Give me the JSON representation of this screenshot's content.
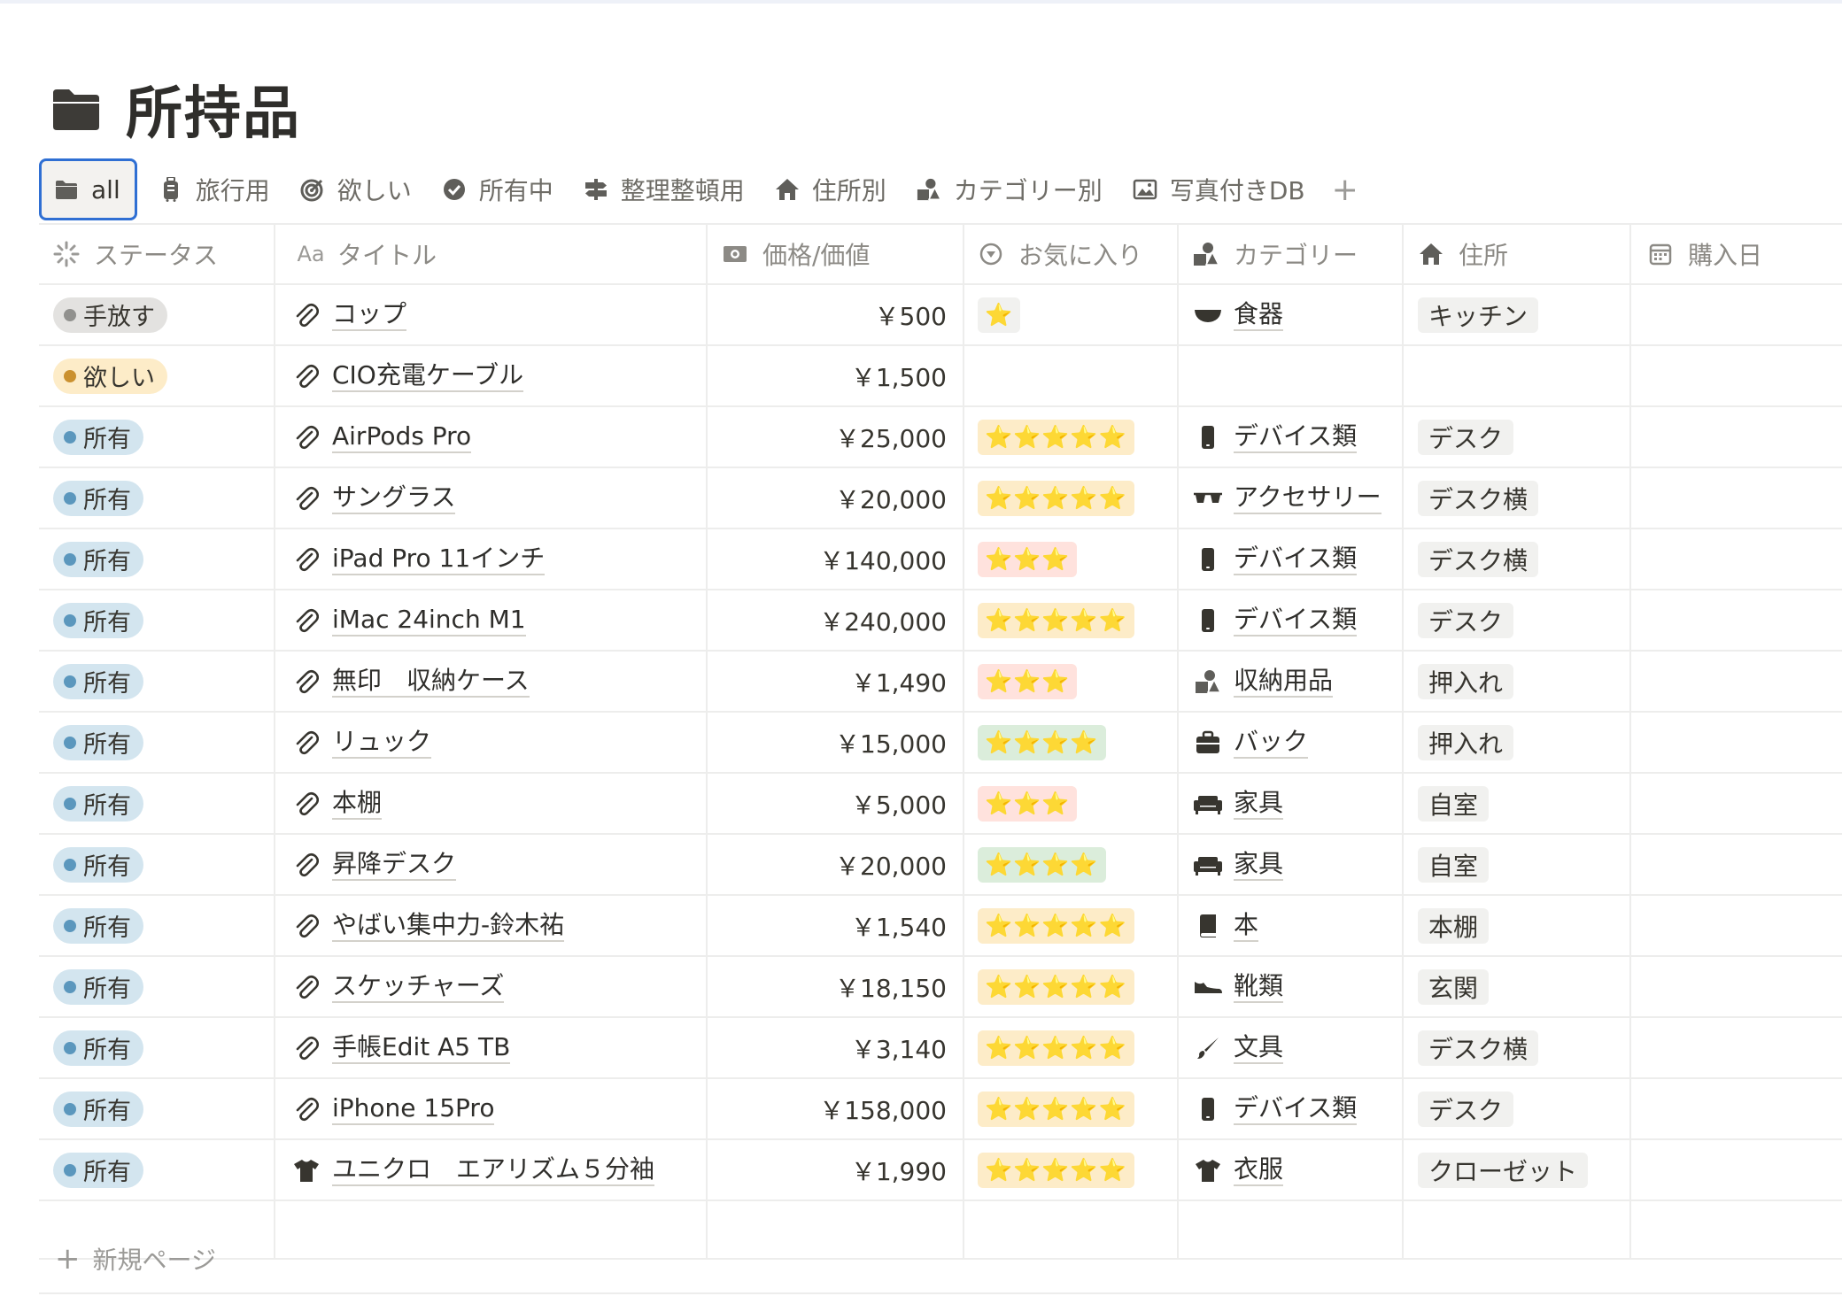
{
  "page": {
    "title": "所持品",
    "icon": "folder-icon"
  },
  "tabs": [
    {
      "label": "all",
      "icon": "folder-icon",
      "active": true
    },
    {
      "label": "旅行用",
      "icon": "luggage-icon"
    },
    {
      "label": "欲しい",
      "icon": "target-icon"
    },
    {
      "label": "所有中",
      "icon": "check-circle-icon"
    },
    {
      "label": "整理整頓用",
      "icon": "signpost-icon"
    },
    {
      "label": "住所別",
      "icon": "home-icon"
    },
    {
      "label": "カテゴリー別",
      "icon": "shapes-icon"
    },
    {
      "label": "写真付きDB",
      "icon": "image-icon"
    }
  ],
  "columns": [
    {
      "label": "ステータス",
      "icon": "status-icon"
    },
    {
      "label": "タイトル",
      "icon": "text-aa-icon",
      "icon_text": "Aa"
    },
    {
      "label": "価格/価値",
      "icon": "money-icon"
    },
    {
      "label": "お気に入り",
      "icon": "select-icon"
    },
    {
      "label": "カテゴリー",
      "icon": "shapes-icon"
    },
    {
      "label": "住所",
      "icon": "home-icon"
    },
    {
      "label": "購入日",
      "icon": "calendar-icon"
    }
  ],
  "status_colors": {
    "手放す": {
      "bg": "#e3e2e0",
      "dot": "#91918e"
    },
    "欲しい": {
      "bg": "#fdecc8",
      "dot": "#cb912f"
    },
    "所有": {
      "bg": "#d3e5ef",
      "dot": "#5b97bd"
    }
  },
  "star_colors": {
    "5": "#fdecc8",
    "4": "#dbeddb",
    "3": "#ffe2dd",
    "1": "#f1f1ef"
  },
  "rows": [
    {
      "status": "手放す",
      "title": "コップ",
      "title_icon": "paperclip-icon",
      "price": "￥500",
      "stars": 1,
      "stars_text": "⭐",
      "category": "食器",
      "category_icon": "bowl-icon",
      "location": "キッチン",
      "date": ""
    },
    {
      "status": "欲しい",
      "title": "CIO充電ケーブル",
      "title_icon": "paperclip-icon",
      "price": "￥1,500",
      "stars": 0,
      "stars_text": "",
      "category": "",
      "category_icon": "",
      "location": "",
      "date": ""
    },
    {
      "status": "所有",
      "title": "AirPods Pro",
      "title_icon": "paperclip-icon",
      "price": "￥25,000",
      "stars": 5,
      "stars_text": "⭐⭐⭐⭐⭐",
      "category": "デバイス類",
      "category_icon": "phone-icon",
      "location": "デスク",
      "date": ""
    },
    {
      "status": "所有",
      "title": "サングラス",
      "title_icon": "paperclip-icon",
      "price": "￥20,000",
      "stars": 5,
      "stars_text": "⭐⭐⭐⭐⭐",
      "category": "アクセサリー",
      "category_icon": "glasses-icon",
      "location": "デスク横",
      "date": ""
    },
    {
      "status": "所有",
      "title": "iPad Pro 11インチ",
      "title_icon": "paperclip-icon",
      "price": "￥140,000",
      "stars": 3,
      "stars_text": "⭐⭐⭐",
      "category": "デバイス類",
      "category_icon": "phone-icon",
      "location": "デスク横",
      "date": ""
    },
    {
      "status": "所有",
      "title": "iMac 24inch M1",
      "title_icon": "paperclip-icon",
      "price": "￥240,000",
      "stars": 5,
      "stars_text": "⭐⭐⭐⭐⭐",
      "category": "デバイス類",
      "category_icon": "phone-icon",
      "location": "デスク",
      "date": ""
    },
    {
      "status": "所有",
      "title": "無印　収納ケース",
      "title_icon": "paperclip-icon",
      "price": "￥1,490",
      "stars": 3,
      "stars_text": "⭐⭐⭐",
      "category": "収納用品",
      "category_icon": "shapes-icon",
      "location": "押入れ",
      "date": ""
    },
    {
      "status": "所有",
      "title": "リュック",
      "title_icon": "paperclip-icon",
      "price": "￥15,000",
      "stars": 4,
      "stars_text": "⭐⭐⭐⭐",
      "category": "バック",
      "category_icon": "briefcase-icon",
      "location": "押入れ",
      "date": ""
    },
    {
      "status": "所有",
      "title": "本棚",
      "title_icon": "paperclip-icon",
      "price": "￥5,000",
      "stars": 3,
      "stars_text": "⭐⭐⭐",
      "category": "家具",
      "category_icon": "sofa-icon",
      "location": "自室",
      "date": ""
    },
    {
      "status": "所有",
      "title": "昇降デスク",
      "title_icon": "paperclip-icon",
      "price": "￥20,000",
      "stars": 4,
      "stars_text": "⭐⭐⭐⭐",
      "category": "家具",
      "category_icon": "sofa-icon",
      "location": "自室",
      "date": ""
    },
    {
      "status": "所有",
      "title": "やばい集中力-鈴木祐",
      "title_icon": "paperclip-icon",
      "price": "￥1,540",
      "stars": 5,
      "stars_text": "⭐⭐⭐⭐⭐",
      "category": "本",
      "category_icon": "book-icon",
      "location": "本棚",
      "date": ""
    },
    {
      "status": "所有",
      "title": "スケッチャーズ",
      "title_icon": "paperclip-icon",
      "price": "￥18,150",
      "stars": 5,
      "stars_text": "⭐⭐⭐⭐⭐",
      "category": "靴類",
      "category_icon": "shoe-icon",
      "location": "玄関",
      "date": ""
    },
    {
      "status": "所有",
      "title": "手帳Edit A5 TB",
      "title_icon": "paperclip-icon",
      "price": "￥3,140",
      "stars": 5,
      "stars_text": "⭐⭐⭐⭐⭐",
      "category": "文具",
      "category_icon": "brush-icon",
      "location": "デスク横",
      "date": ""
    },
    {
      "status": "所有",
      "title": "iPhone 15Pro",
      "title_icon": "paperclip-icon",
      "price": "￥158,000",
      "stars": 5,
      "stars_text": "⭐⭐⭐⭐⭐",
      "category": "デバイス類",
      "category_icon": "phone-icon",
      "location": "デスク",
      "date": ""
    },
    {
      "status": "所有",
      "title": "ユニクロ　エアリズム５分袖",
      "title_icon": "tshirt-icon",
      "price": "￥1,990",
      "stars": 5,
      "stars_text": "⭐⭐⭐⭐⭐",
      "category": "衣服",
      "category_icon": "tshirt-icon",
      "location": "クローゼット",
      "date": ""
    }
  ],
  "new_page_label": "新規ページ",
  "add_view_symbol": "+"
}
